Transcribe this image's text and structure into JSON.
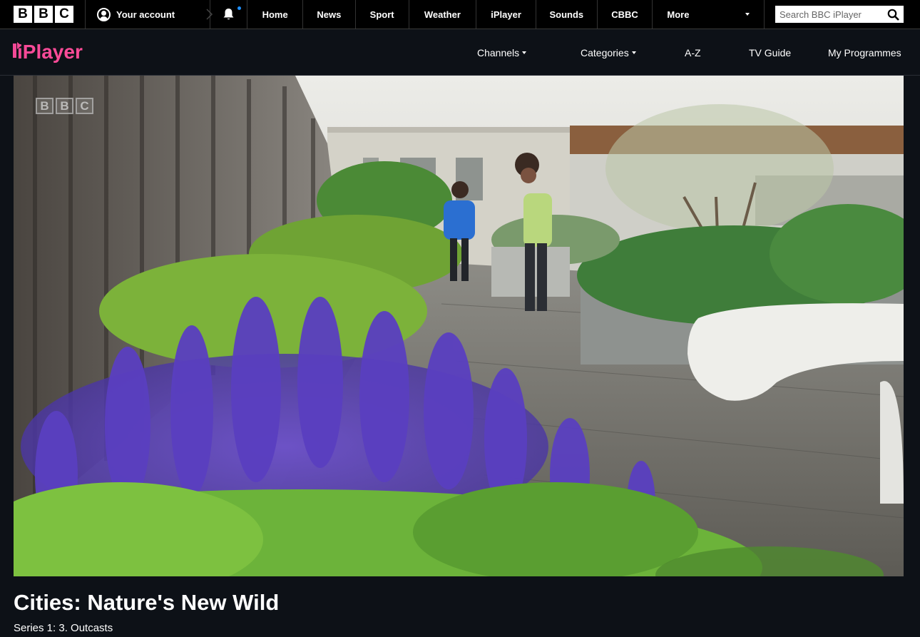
{
  "bbc_bar": {
    "logo": [
      "B",
      "B",
      "C"
    ],
    "account_label": "Your account",
    "nav": [
      "Home",
      "News",
      "Sport",
      "Weather",
      "iPlayer",
      "Sounds",
      "CBBC"
    ],
    "more_label": "More",
    "search_placeholder": "Search BBC iPlayer"
  },
  "iplayer_bar": {
    "logo_text": "iPlayer",
    "nav": {
      "channels": "Channels",
      "categories": "Categories",
      "az": "A-Z",
      "tv_guide": "TV Guide",
      "my_programmes": "My Programmes"
    }
  },
  "player": {
    "watermark": [
      "B",
      "B",
      "C"
    ]
  },
  "programme": {
    "title": "Cities: Nature's New Wild",
    "episode": "Series 1: 3. Outcasts"
  },
  "colors": {
    "page_bg": "#0d1117",
    "bar_bg": "#000000",
    "iplayer_pink": "#f54997",
    "notification_dot": "#1e90ff"
  },
  "icons": {
    "account": "account-icon",
    "notifications": "bell-icon",
    "search": "search-icon",
    "more": "chevron-down-icon"
  }
}
